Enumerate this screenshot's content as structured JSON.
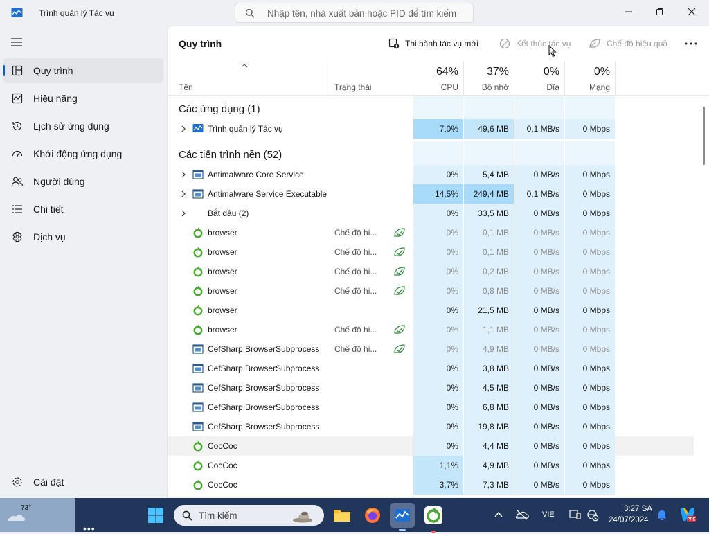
{
  "window": {
    "title": "Trình quản lý Tác vụ",
    "search_placeholder": "Nhập tên, nhà xuất bản hoặc PID để tìm kiếm"
  },
  "nav": {
    "items": [
      {
        "label": "Quy trình",
        "icon": "processes-icon",
        "active": true
      },
      {
        "label": "Hiệu năng",
        "icon": "performance-icon"
      },
      {
        "label": "Lịch sử ứng dụng",
        "icon": "history-icon"
      },
      {
        "label": "Khởi động ứng dụng",
        "icon": "startup-icon"
      },
      {
        "label": "Người dùng",
        "icon": "users-icon"
      },
      {
        "label": "Chi tiết",
        "icon": "details-icon"
      },
      {
        "label": "Dịch vụ",
        "icon": "services-icon"
      }
    ],
    "settings": "Cài đặt"
  },
  "toolbar": {
    "title": "Quy trình",
    "run_new_task": "Thi hành tác vụ mới",
    "end_task": "Kết thúc tác vụ",
    "efficiency_mode": "Chế độ hiệu quả"
  },
  "columns": {
    "name": "Tên",
    "status": "Trạng thái",
    "cpu": {
      "pct": "64%",
      "label": "CPU"
    },
    "memory": {
      "pct": "37%",
      "label": "Bộ nhớ"
    },
    "disk": {
      "pct": "0%",
      "label": "Đĩa"
    },
    "network": {
      "pct": "0%",
      "label": "Mạng"
    }
  },
  "groups": {
    "apps": "Các ứng dụng (1)",
    "background": "Các tiến trình nền (52)"
  },
  "processes": [
    {
      "name": "Trình quản lý Tác vụ",
      "icon": "taskmgr",
      "expandable": true,
      "status": "",
      "cpu": "7,0%",
      "memory": "49,6 MB",
      "disk": "0,1 MB/s",
      "network": "0 Mbps"
    },
    {
      "name": "Antimalware Core Service",
      "icon": "service",
      "expandable": true,
      "status": "",
      "cpu": "0%",
      "memory": "5,4 MB",
      "disk": "0 MB/s",
      "network": "0 Mbps"
    },
    {
      "name": "Antimalware Service Executable",
      "icon": "service",
      "expandable": true,
      "status": "",
      "cpu": "14,5%",
      "memory": "249,4 MB",
      "disk": "0,1 MB/s",
      "network": "0 Mbps"
    },
    {
      "name": "Bắt đầu (2)",
      "icon": "none",
      "expandable": true,
      "status": "",
      "cpu": "0%",
      "memory": "33,5 MB",
      "disk": "0 MB/s",
      "network": "0 Mbps"
    },
    {
      "name": "browser",
      "icon": "coccoc",
      "status": "Chế độ hi...",
      "eco": true,
      "cpu": "0%",
      "memory": "0,1 MB",
      "disk": "0 MB/s",
      "network": "0 Mbps"
    },
    {
      "name": "browser",
      "icon": "coccoc",
      "status": "Chế độ hi...",
      "eco": true,
      "cpu": "0%",
      "memory": "0,1 MB",
      "disk": "0 MB/s",
      "network": "0 Mbps"
    },
    {
      "name": "browser",
      "icon": "coccoc",
      "status": "Chế độ hi...",
      "eco": true,
      "cpu": "0%",
      "memory": "0,2 MB",
      "disk": "0 MB/s",
      "network": "0 Mbps"
    },
    {
      "name": "browser",
      "icon": "coccoc",
      "status": "Chế độ hi...",
      "eco": true,
      "cpu": "0%",
      "memory": "0,8 MB",
      "disk": "0 MB/s",
      "network": "0 Mbps"
    },
    {
      "name": "browser",
      "icon": "coccoc",
      "status": "",
      "cpu": "0%",
      "memory": "21,5 MB",
      "disk": "0 MB/s",
      "network": "0 Mbps"
    },
    {
      "name": "browser",
      "icon": "coccoc",
      "status": "Chế độ hi...",
      "eco": true,
      "cpu": "0%",
      "memory": "1,1 MB",
      "disk": "0 MB/s",
      "network": "0 Mbps"
    },
    {
      "name": "CefSharp.BrowserSubprocess",
      "icon": "service",
      "status": "Chế độ hi...",
      "eco": true,
      "cpu": "0%",
      "memory": "4,9 MB",
      "disk": "0 MB/s",
      "network": "0 Mbps"
    },
    {
      "name": "CefSharp.BrowserSubprocess",
      "icon": "service",
      "status": "",
      "cpu": "0%",
      "memory": "3,8 MB",
      "disk": "0 MB/s",
      "network": "0 Mbps"
    },
    {
      "name": "CefSharp.BrowserSubprocess",
      "icon": "service",
      "status": "",
      "cpu": "0%",
      "memory": "4,5 MB",
      "disk": "0 MB/s",
      "network": "0 Mbps"
    },
    {
      "name": "CefSharp.BrowserSubprocess",
      "icon": "service",
      "status": "",
      "cpu": "0%",
      "memory": "6,8 MB",
      "disk": "0 MB/s",
      "network": "0 Mbps"
    },
    {
      "name": "CefSharp.BrowserSubprocess",
      "icon": "service",
      "status": "",
      "cpu": "0%",
      "memory": "19,8 MB",
      "disk": "0 MB/s",
      "network": "0 Mbps"
    },
    {
      "name": "CocCoc",
      "icon": "coccoc",
      "status": "",
      "hover": true,
      "cpu": "0%",
      "memory": "4,4 MB",
      "disk": "0 MB/s",
      "network": "0 Mbps"
    },
    {
      "name": "CocCoc",
      "icon": "coccoc",
      "status": "",
      "cpu": "1,1%",
      "memory": "4,9 MB",
      "disk": "0 MB/s",
      "network": "0 Mbps"
    },
    {
      "name": "CocCoc",
      "icon": "coccoc",
      "status": "",
      "cpu": "3,7%",
      "memory": "7,3 MB",
      "disk": "0 MB/s",
      "network": "0 Mbps"
    }
  ],
  "taskbar": {
    "temperature": "73°",
    "search": "Tìm kiếm",
    "language": "VIE",
    "time": "3:27 SA",
    "date": "24/07/2024"
  },
  "colors": {
    "heat_light": "#ddf0fc",
    "heat_mid": "#c4e6fb",
    "heat_strong": "#a8dafa",
    "accent": "#0f5cc0",
    "coccoc_green": "#4aa832"
  }
}
